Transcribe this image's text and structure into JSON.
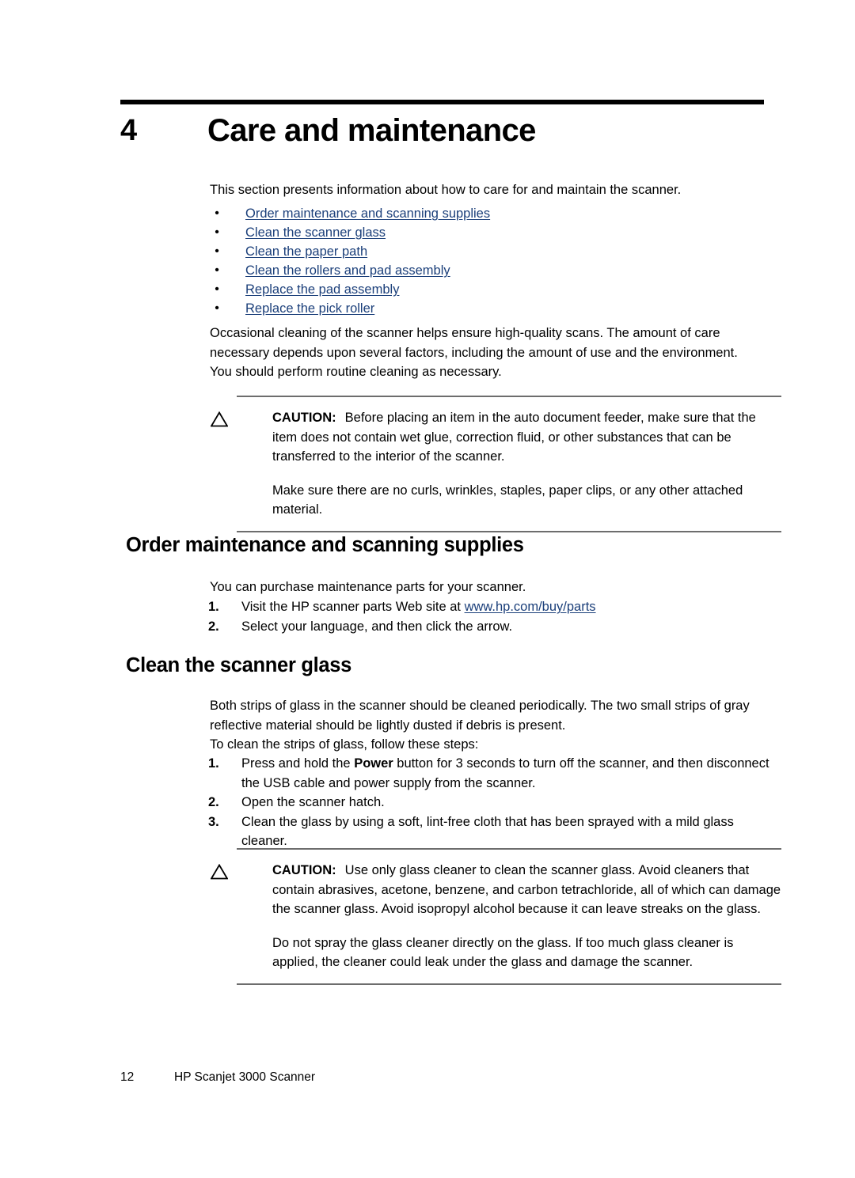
{
  "document": {
    "chapter_number": "4",
    "chapter_title": "Care and maintenance",
    "intro": "This section presents information about how to care for and maintain the scanner.",
    "toc_links": [
      {
        "label": "Order maintenance and scanning supplies"
      },
      {
        "label": "Clean the scanner glass"
      },
      {
        "label": "Clean the paper path"
      },
      {
        "label": "Clean the rollers and pad assembly"
      },
      {
        "label": "Replace the pad assembly"
      },
      {
        "label": "Replace the pick roller"
      }
    ],
    "bullet_glyph": "•",
    "intro_paragraph": "Occasional cleaning of the scanner helps ensure high-quality scans. The amount of care necessary depends upon several factors, including the amount of use and the environment. You should perform routine cleaning as necessary.",
    "caution_1": {
      "label": "CAUTION:",
      "paragraph_1": "Before placing an item in the auto document feeder, make sure that the item does not contain wet glue, correction fluid, or other substances that can be transferred to the interior of the scanner.",
      "paragraph_2": "Make sure there are no curls, wrinkles, staples, paper clips, or any other attached material.",
      "icon": "caution-triangle-icon"
    },
    "section_order": {
      "heading": "Order maintenance and scanning supplies",
      "intro": "You can purchase maintenance parts for your scanner.",
      "steps": [
        {
          "number": "1.",
          "text_before": "Visit the HP scanner parts Web site at ",
          "link": "www.hp.com/buy/parts",
          "text_after": ""
        },
        {
          "number": "2.",
          "text_before": "Select your language, and then click the arrow.",
          "link": "",
          "text_after": ""
        }
      ]
    },
    "section_glass": {
      "heading": "Clean the scanner glass",
      "intro_1": "Both strips of glass in the scanner should be cleaned periodically. The two small strips of gray reflective material should be lightly dusted if debris is present.",
      "intro_2": "To clean the strips of glass, follow these steps:",
      "steps": [
        {
          "number": "1.",
          "text_before": "Press and hold the ",
          "bold": "Power",
          "text_after": " button for 3 seconds to turn off the scanner, and then disconnect the USB cable and power supply from the scanner."
        },
        {
          "number": "2.",
          "text_before": "Open the scanner hatch.",
          "bold": "",
          "text_after": ""
        },
        {
          "number": "3.",
          "text_before": "Clean the glass by using a soft, lint-free cloth that has been sprayed with a mild glass cleaner.",
          "bold": "",
          "text_after": ""
        }
      ]
    },
    "caution_2": {
      "label": "CAUTION:",
      "paragraph_1": "Use only glass cleaner to clean the scanner glass. Avoid cleaners that contain abrasives, acetone, benzene, and carbon tetrachloride, all of which can damage the scanner glass. Avoid isopropyl alcohol because it can leave streaks on the glass.",
      "paragraph_2": "Do not spray the glass cleaner directly on the glass. If too much glass cleaner is applied, the cleaner could leak under the glass and damage the scanner.",
      "icon": "caution-triangle-icon"
    },
    "footer": {
      "page_number": "12",
      "product": "HP Scanjet 3000 Scanner"
    },
    "colors": {
      "link": "#1b3f7a",
      "rule": "#6d6d6d",
      "text": "#000000"
    }
  }
}
